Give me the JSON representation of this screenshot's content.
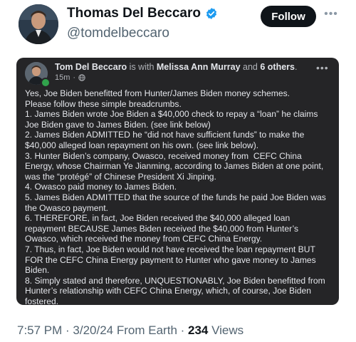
{
  "author": {
    "display_name": "Thomas Del Beccaro",
    "handle": "@tomdelbeccaro",
    "verified": true,
    "follow_label": "Follow",
    "more_icon": "more-horizontal-icon"
  },
  "embedded_post": {
    "author_name": "Tom Del Beccaro",
    "with_text": " is with ",
    "tagged": "Melissa Ann Murray",
    "and_text": " and ",
    "others": "6 others",
    "period": ".",
    "time": "15m",
    "separator": "·",
    "audience_icon": "globe-icon",
    "more_icon": "more-horizontal-icon",
    "body": "Yes, Joe Biden benefitted from Hunter/James Biden money schemes.\nPlease follow these simple breadcrumbs.\n1. James Biden wrote Joe Biden a $40,000 check to repay a “loan” he claims Joe Biden gave to James Biden. (see link below)\n2. James Biden ADMITTED he “did not have sufficient funds” to make the $40,000 alleged loan repayment on his own. (see link below).\n3. Hunter Biden’s company, Owasco, received money from  CEFC China Energy, whose Chairman Ye Jianming, according to James Biden at one point, was the “protégé” of Chinese President Xi Jinping.\n4. Owasco paid money to James Biden.\n5. James Biden ADMITTED that the source of the funds he paid Joe Biden was the Owasco payment.\n6. THEREFORE, in fact, Joe Biden received the $40,000 alleged loan repayment BECAUSE James Biden received the $40,000 from Hunter’s Owasco, which received the money from CEFC China Energy.\n7. Thus, in fact, Joe Biden would not have received the loan repayment BUT FOR the CEFC China Energy payment to Hunter who gave money to James Biden.\n8. Simply stated and therefore, UNQUESTIONABLY, Joe Biden benefitted from Hunter’s relationship with CEFC China Energy, which, of course, Joe Biden fostered."
  },
  "footer": {
    "time": "7:57 PM",
    "sep1": " · ",
    "date": "3/20/24",
    "source": " From Earth",
    "sep2": " · ",
    "views_count": "234",
    "views_label": " Views"
  },
  "colors": {
    "follow_bg": "#0f1419",
    "verified": "#1d9bf0",
    "card_bg": "#252527",
    "online": "#31a24c"
  }
}
